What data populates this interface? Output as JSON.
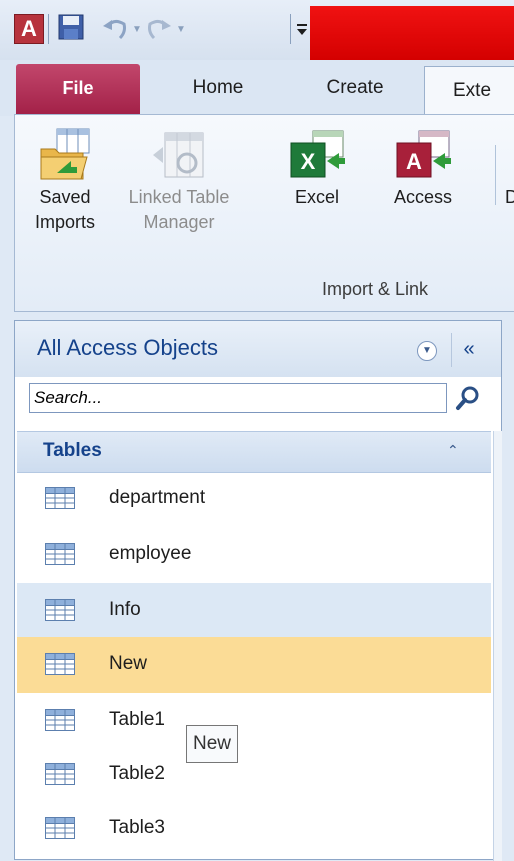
{
  "app": {
    "logo_letter": "A"
  },
  "tabs": {
    "file": "File",
    "home": "Home",
    "create": "Create",
    "external": "Exte"
  },
  "ribbon": {
    "buttons": [
      {
        "line1": "Saved",
        "line2": "Imports"
      },
      {
        "line1": "Linked Table",
        "line2": "Manager"
      },
      {
        "line1": "Excel",
        "line2": ""
      },
      {
        "line1": "Access",
        "line2": ""
      },
      {
        "line1": "",
        "line2": "D"
      }
    ],
    "group_label": "Import & Link"
  },
  "nav_pane": {
    "title": "All Access Objects",
    "collapse_glyph": "«",
    "search_placeholder": "Search...",
    "group": {
      "title": "Tables",
      "collapse_glyph": "⌃"
    },
    "items": [
      {
        "label": "department"
      },
      {
        "label": "employee"
      },
      {
        "label": "Info"
      },
      {
        "label": "New"
      },
      {
        "label": "Table1"
      },
      {
        "label": "Table2"
      },
      {
        "label": "Table3"
      }
    ]
  },
  "tooltip": {
    "text": "New"
  }
}
